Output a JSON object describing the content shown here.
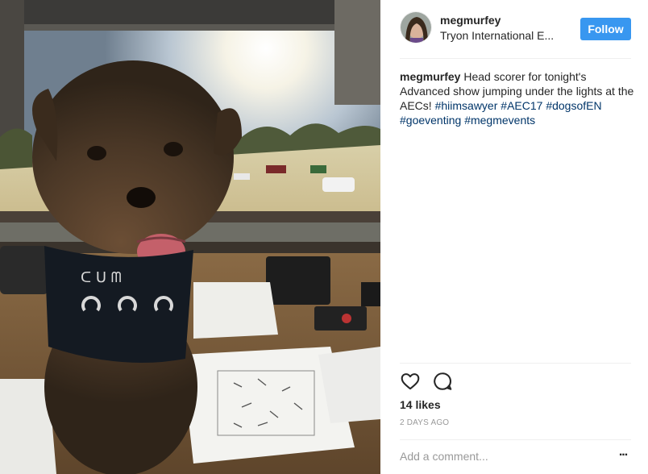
{
  "post": {
    "photo_alt": "Dog wearing a bandana in a scorer's booth overlooking an arena",
    "username": "megmurfey",
    "location": "Tryon International E...",
    "follow_label": "Follow",
    "caption": {
      "username": "megmurfey",
      "text_1": " Head scorer for tonight's Advanced show jumping under the lights at the AECs! ",
      "hashtags": [
        "#hiimsawyer",
        "#AEC17",
        "#dogsofEN",
        "#goeventing",
        "#megmevents"
      ]
    },
    "likes": "14 likes",
    "timestamp": "2 DAYS AGO",
    "comment_placeholder": "Add a comment...",
    "more_label": "..."
  },
  "icons": {
    "like": "heart-icon",
    "comment": "comment-bubble-icon",
    "more": "ellipsis-icon"
  },
  "colors": {
    "accent": "#3897f0",
    "hashtag": "#003569",
    "muted": "#999999",
    "divider": "#efefef"
  }
}
